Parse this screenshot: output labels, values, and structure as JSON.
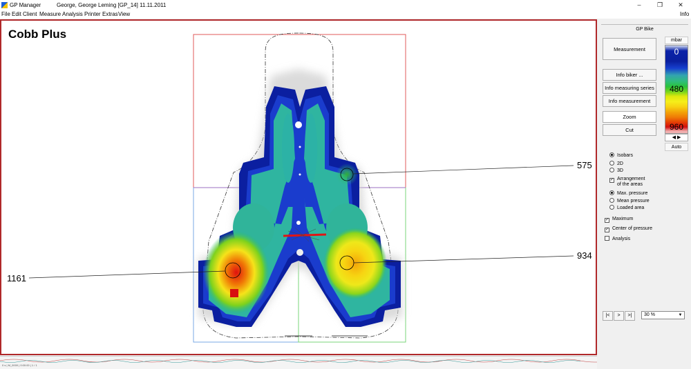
{
  "window": {
    "app_title": "GP Manager",
    "doc_info": "George, George Leming    [GP_14]    11.11.2011",
    "minimize": "–",
    "maximize": "❐",
    "close": "✕"
  },
  "menu": {
    "items": [
      "File",
      "Edit",
      "Client",
      "Measure",
      "Analysis",
      "Printer",
      "Extras",
      "View"
    ],
    "right": "Info"
  },
  "map": {
    "title": "Cobb Plus",
    "values": {
      "upper_right": "575",
      "left": "1161",
      "right": "934"
    }
  },
  "panel": {
    "header": "GP Bike",
    "buttons": {
      "measurement": "Measurement",
      "info_biker": "Info biker ...",
      "info_series": "Info measuring series",
      "info_measurement": "Info measurement",
      "zoom": "Zoom",
      "cut": "Cut"
    },
    "legend": {
      "unit": "mbar",
      "ticks": [
        "0",
        "480",
        "960"
      ],
      "auto": "Auto",
      "arrows": "◀  ▶"
    },
    "view_options": {
      "isobars": "Isobars",
      "d2": "2D",
      "d3": "3D",
      "arrangement_l1": "Arrangement",
      "arrangement_l2": "of the areas"
    },
    "pressure_options": {
      "max": "Max. pressure",
      "mean": "Mean pressure",
      "loaded": "Loaded area"
    },
    "checks": {
      "maximum": "Maximum",
      "center": "Center of pressure",
      "analysis": "Analysis"
    },
    "nav": {
      "first": "|<",
      "next": ">",
      "last": ">|"
    },
    "zoom_value": "30 %"
  },
  "status": {
    "text": "0 s  |  M_0000  |  0:00:00  |  1 / 1"
  }
}
